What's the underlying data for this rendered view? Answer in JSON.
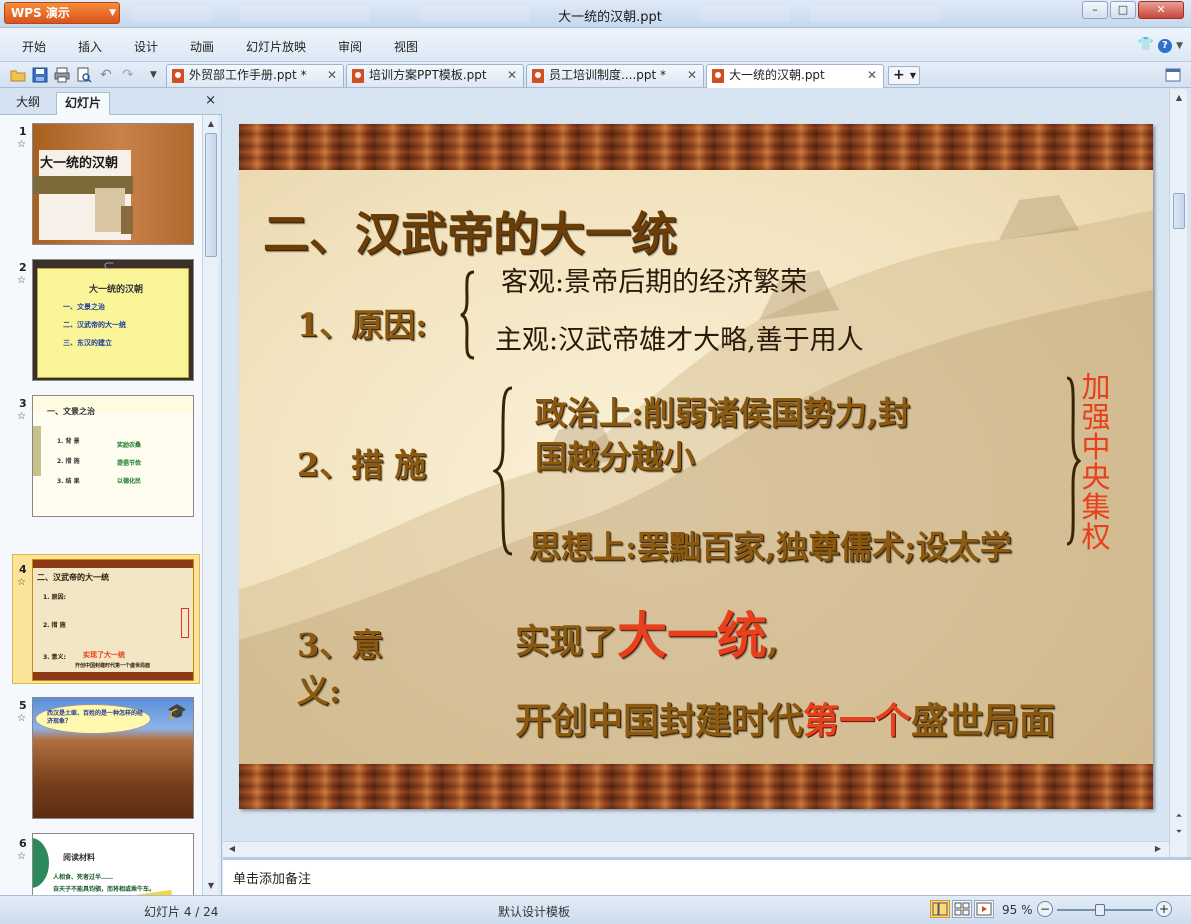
{
  "app": {
    "logo_label": "WPS 演示",
    "window_title": "大一统的汉朝.ppt",
    "window_buttons": [
      "–",
      "□",
      "✕"
    ]
  },
  "menu": {
    "items": [
      "开始",
      "插入",
      "设计",
      "动画",
      "幻灯片放映",
      "审阅",
      "视图"
    ]
  },
  "toolbar": {
    "icons": [
      "open-folder-icon",
      "save-icon",
      "print-icon",
      "print-preview-icon",
      "undo-icon",
      "redo-icon",
      "dropdown-icon"
    ]
  },
  "tabs": [
    {
      "label": "外贸部工作手册.ppt *",
      "active": false
    },
    {
      "label": "培训方案PPT模板.ppt",
      "active": false
    },
    {
      "label": "员工培训制度....ppt *",
      "active": false
    },
    {
      "label": "大一统的汉朝.ppt",
      "active": true
    }
  ],
  "panel": {
    "tabs": [
      "大纲",
      "幻灯片"
    ],
    "active_tab": "幻灯片",
    "close": "×"
  },
  "thumbnails": [
    {
      "num": "1",
      "title": "大一统的汉朝"
    },
    {
      "num": "2",
      "title": "大一统的汉朝",
      "items": [
        "一、文景之治",
        "二、汉武帝的大一统",
        "三、东汉的建立"
      ]
    },
    {
      "num": "3",
      "title": "一、文景之治",
      "rows": [
        [
          "1. 背  景",
          "奖励农桑"
        ],
        [
          "2. 措  施",
          "提倡节俭"
        ],
        [
          "3. 结  果",
          "以德化民"
        ]
      ]
    },
    {
      "num": "4",
      "title": "二、汉武帝的大一统",
      "rows": [
        "1. 原因:",
        "2. 措 施",
        "3. 意义:"
      ],
      "bottom": "开创中国封建时代第一个盛世局面",
      "highlight": "实现了大一统"
    },
    {
      "num": "5",
      "bubble": "西汉是土匪、百姓的是一种怎样的经济现象？"
    },
    {
      "num": "6",
      "heading": "阅读材料",
      "lines": [
        "人相食、死者过半……",
        "自天子不能具钧驷，而将相或乘牛车。"
      ]
    }
  ],
  "slide": {
    "title": "二、汉武帝的大一统",
    "reason_label": "1、原因:",
    "reason_objective": "客观:景帝后期的经济繁荣",
    "reason_subjective": "主观:汉武帝雄才大略,善于用人",
    "measures_label": "2、措  施",
    "measure_political_1": "政治上:削弱诸侯国势力,封",
    "measure_political_2": "国越分越小",
    "measure_ideology": "思想上:罢黜百家,独尊儒术;设太学",
    "side_note": "加强中央集权",
    "significance_label_1": "3、意",
    "significance_label_2": "义:",
    "significance_1_pre": "实现了",
    "significance_1_big": "大一统",
    "significance_1_post": ",",
    "significance_2_pre": "开创中国封建时代",
    "significance_2_red": "第一个",
    "significance_2_post": "盛世局面",
    "colors": {
      "gold": "#8b5a10",
      "red": "#e8401c",
      "dark": "#2a1a0a"
    }
  },
  "notes": {
    "placeholder": "单击添加备注"
  },
  "status": {
    "slide_counter": "幻灯片 4 / 24",
    "template": "默认设计模板",
    "zoom": "95 %",
    "zoom_fraction": 0.5
  }
}
